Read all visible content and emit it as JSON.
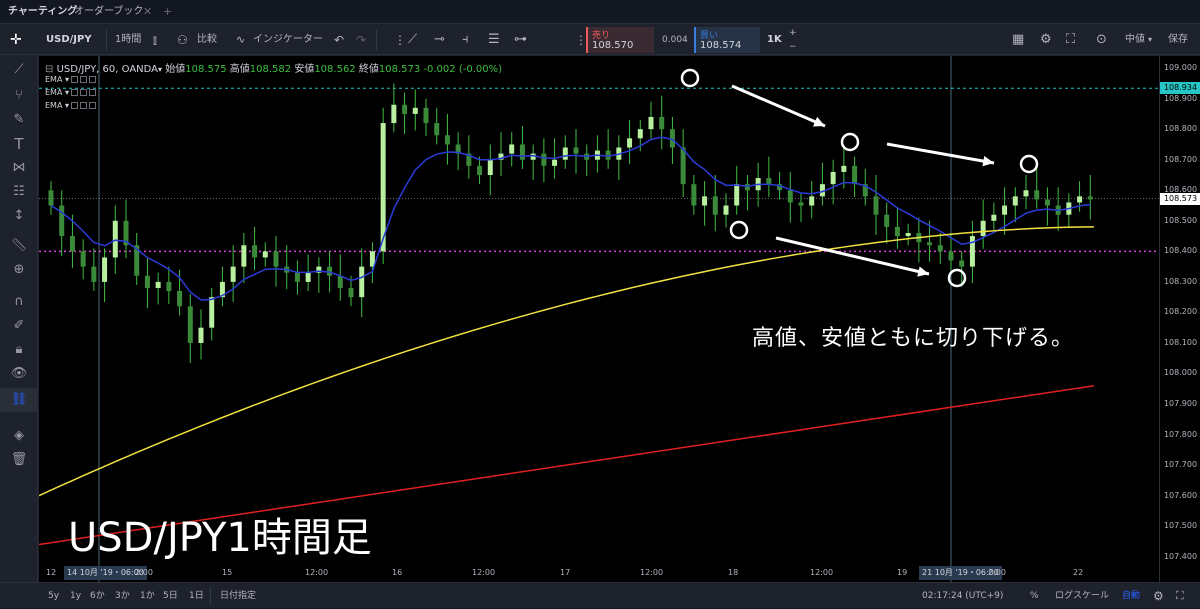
{
  "tabs": {
    "charting": "チャーティング",
    "orderbook": "オーダーブック",
    "close": "✕",
    "add": "+"
  },
  "toolbar": {
    "symbol": "USD/JPY",
    "interval": "1時間",
    "compare": "比較",
    "indicators": "インジケーター",
    "sell_label": "売り",
    "sell_price": "108.570",
    "spread": "0.004",
    "buy_label": "買い",
    "buy_price": "108.574",
    "qty": "1K",
    "layout": "中値",
    "save": "保存"
  },
  "legend": {
    "title": "USD/JPY, 60, OANDA",
    "open_label": "始値",
    "open": "108.575",
    "high_label": "高値",
    "high": "108.582",
    "low_label": "安値",
    "low": "108.562",
    "close_label": "終値",
    "close": "108.573",
    "change": "-0.002 (-0.00%)",
    "ema1": "EMA",
    "ema2": "EMA",
    "ema3": "EMA"
  },
  "price_axis": {
    "ticks": [
      "109.000",
      "108.900",
      "108.800",
      "108.700",
      "108.600",
      "108.500",
      "108.400",
      "108.300",
      "108.200",
      "108.100",
      "108.000",
      "107.900",
      "107.800",
      "107.700",
      "107.600",
      "107.500",
      "107.400"
    ],
    "tag_cyan": "108.934",
    "tag_price": "108.573"
  },
  "time_axis": {
    "ticks": [
      "12",
      "14 10月 '19・06:00",
      "2:00",
      "15",
      "12:00",
      "16",
      "12:00",
      "17",
      "12:00",
      "18",
      "12:00",
      "19",
      "21 10月 '19・06:00",
      "2:00",
      "22"
    ]
  },
  "bottom": {
    "ranges": [
      "5y",
      "1y",
      "6か",
      "3か",
      "1か",
      "5日",
      "1日"
    ],
    "goto": "日付指定",
    "time": "02:17:24 (UTC+9)",
    "pct": "%",
    "log": "ログスケール",
    "auto": "自動"
  },
  "annotation": "高値、安値ともに切り下げる。",
  "caption": "USD/JPY1時間足",
  "colors": {
    "ema_fast": "#2b3bd6",
    "ema_mid": "#f0e040",
    "ema_slow": "#e02020",
    "candle": "#b8f0a0",
    "h_cyan": "#26c6c6",
    "h_magenta": "#e040e0"
  },
  "chart_data": {
    "type": "candlestick",
    "symbol": "USD/JPY",
    "ylim": [
      107.35,
      109.02
    ],
    "closes": [
      108.55,
      108.45,
      108.4,
      108.35,
      108.3,
      108.38,
      108.5,
      108.42,
      108.32,
      108.28,
      108.3,
      108.27,
      108.22,
      108.1,
      108.15,
      108.25,
      108.3,
      108.35,
      108.42,
      108.38,
      108.4,
      108.35,
      108.33,
      108.3,
      108.33,
      108.35,
      108.32,
      108.28,
      108.25,
      108.35,
      108.4,
      108.82,
      108.88,
      108.85,
      108.87,
      108.82,
      108.78,
      108.75,
      108.72,
      108.68,
      108.65,
      108.7,
      108.72,
      108.75,
      108.7,
      108.72,
      108.68,
      108.7,
      108.74,
      108.72,
      108.7,
      108.73,
      108.7,
      108.74,
      108.77,
      108.8,
      108.84,
      108.8,
      108.74,
      108.62,
      108.55,
      108.58,
      108.52,
      108.55,
      108.62,
      108.6,
      108.64,
      108.62,
      108.6,
      108.56,
      108.55,
      108.58,
      108.62,
      108.66,
      108.68,
      108.62,
      108.58,
      108.52,
      108.48,
      108.45,
      108.46,
      108.43,
      108.42,
      108.4,
      108.37,
      108.35,
      108.45,
      108.5,
      108.52,
      108.55,
      108.58,
      108.6,
      108.57,
      108.55,
      108.52,
      108.56,
      108.58,
      108.57
    ]
  }
}
